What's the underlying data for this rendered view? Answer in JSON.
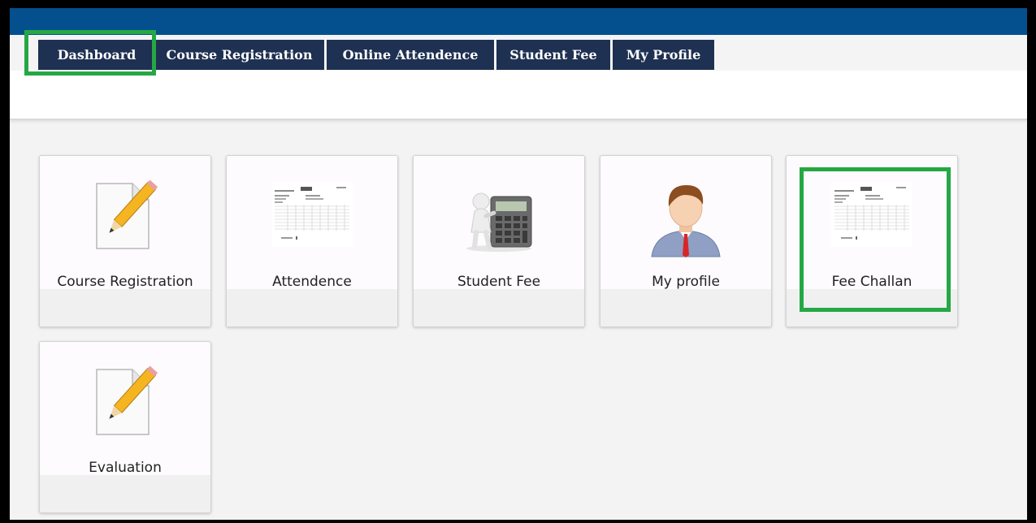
{
  "nav": {
    "tabs": [
      {
        "label": "Dashboard"
      },
      {
        "label": "Course Registration"
      },
      {
        "label": "Online Attendence"
      },
      {
        "label": "Student Fee"
      },
      {
        "label": "My Profile"
      }
    ]
  },
  "tiles": [
    {
      "label": "Course Registration",
      "icon": "pencil-paper-icon"
    },
    {
      "label": "Attendence",
      "icon": "document-thumbnail-icon"
    },
    {
      "label": "Student Fee",
      "icon": "calculator-icon"
    },
    {
      "label": "My profile",
      "icon": "user-avatar-icon"
    },
    {
      "label": "Fee Challan",
      "icon": "document-thumbnail-icon"
    },
    {
      "label": "Evaluation",
      "icon": "pencil-paper-icon"
    }
  ],
  "colors": {
    "topbar": "#04508f",
    "nav_tab": "#1f3152",
    "highlight": "#25a844"
  }
}
